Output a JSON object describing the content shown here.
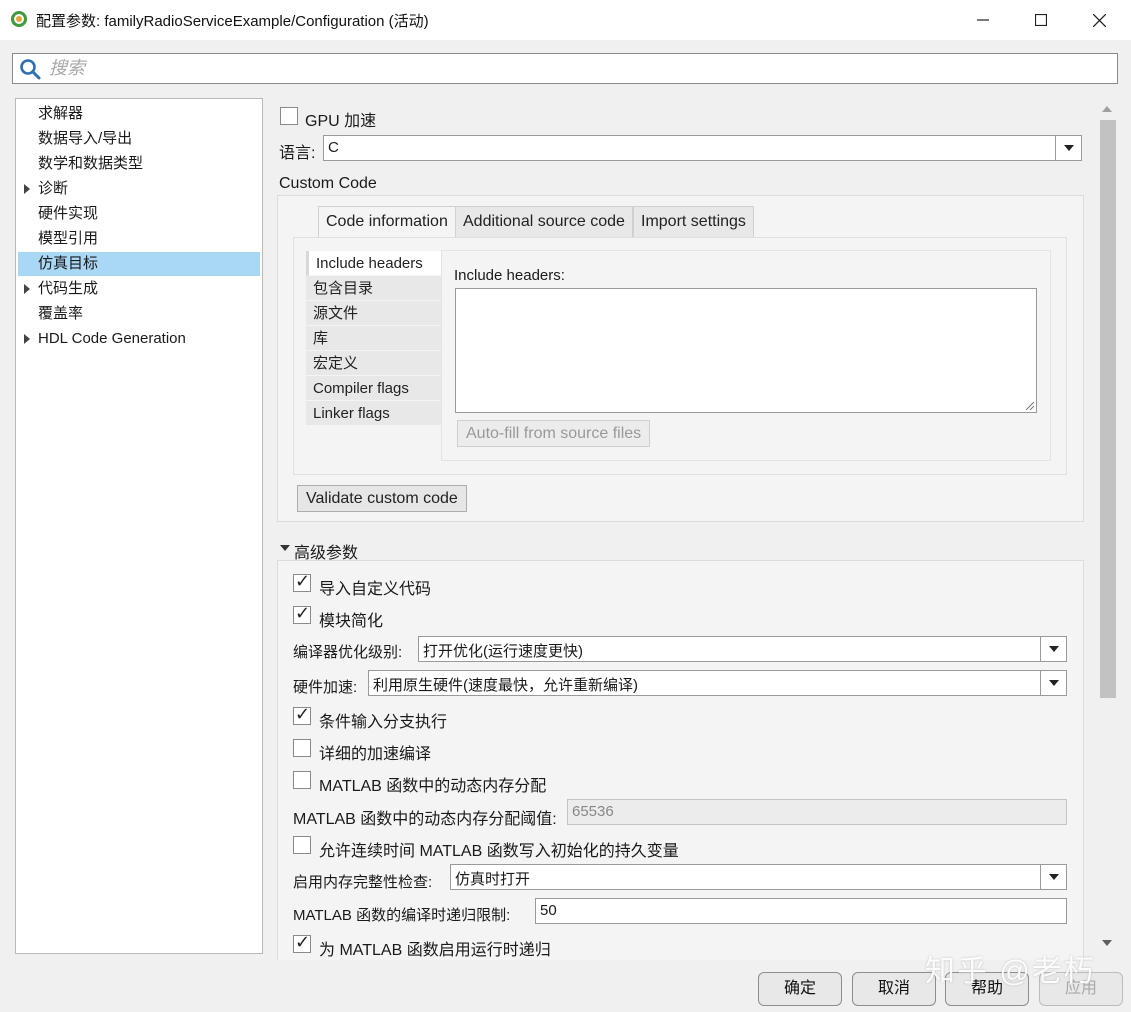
{
  "window": {
    "title": "配置参数: familyRadioServiceExample/Configuration (活动)",
    "icon": "simulink-config-icon",
    "controls": [
      "minimize-icon",
      "maximize-icon",
      "close-icon"
    ]
  },
  "search": {
    "placeholder": "搜索",
    "value": ""
  },
  "tree": {
    "items": [
      {
        "label": "求解器",
        "expandable": false,
        "selected": false
      },
      {
        "label": "数据导入/导出",
        "expandable": false,
        "selected": false
      },
      {
        "label": "数学和数据类型",
        "expandable": false,
        "selected": false
      },
      {
        "label": "诊断",
        "expandable": true,
        "selected": false
      },
      {
        "label": "硬件实现",
        "expandable": false,
        "selected": false
      },
      {
        "label": "模型引用",
        "expandable": false,
        "selected": false
      },
      {
        "label": "仿真目标",
        "expandable": false,
        "selected": true
      },
      {
        "label": "代码生成",
        "expandable": true,
        "selected": false
      },
      {
        "label": "覆盖率",
        "expandable": false,
        "selected": false
      },
      {
        "label": "HDL Code Generation",
        "expandable": true,
        "selected": false
      }
    ]
  },
  "main": {
    "gpu_label": "GPU 加速",
    "gpu_checked": false,
    "language_label": "语言:",
    "language_value": "C",
    "custom_code_heading": "Custom Code",
    "tabs": [
      {
        "label": "Code information",
        "active": true
      },
      {
        "label": "Additional source code",
        "active": false
      },
      {
        "label": "Import settings",
        "active": false
      }
    ],
    "side_tabs": [
      {
        "label": "Include headers",
        "active": true
      },
      {
        "label": "包含目录",
        "active": false
      },
      {
        "label": "源文件",
        "active": false
      },
      {
        "label": "库",
        "active": false
      },
      {
        "label": "宏定义",
        "active": false
      },
      {
        "label": "Compiler flags",
        "active": false
      },
      {
        "label": "Linker flags",
        "active": false
      }
    ],
    "include_headers_label": "Include headers:",
    "include_headers_value": "",
    "autofill_button": "Auto-fill from source files",
    "validate_button": "Validate custom code",
    "advanced_heading": "高级参数",
    "advanced": {
      "import_custom_code": {
        "label": "导入自定义代码",
        "checked": true
      },
      "block_reduction": {
        "label": "模块简化",
        "checked": true
      },
      "compiler_opt_label": "编译器优化级别:",
      "compiler_opt_value": "打开优化(运行速度更快)",
      "hw_accel_label": "硬件加速:",
      "hw_accel_value": "利用原生硬件(速度最快，允许重新编译)",
      "conditional_branch": {
        "label": "条件输入分支执行",
        "checked": true
      },
      "verbose_accel": {
        "label": "详细的加速编译",
        "checked": false
      },
      "dynamic_mem": {
        "label": "MATLAB 函数中的动态内存分配",
        "checked": false
      },
      "dynamic_mem_threshold_label": "MATLAB 函数中的动态内存分配阈值:",
      "dynamic_mem_threshold_value": "65536",
      "persistent_vars": {
        "label": "允许连续时间 MATLAB 函数写入初始化的持久变量",
        "checked": false
      },
      "mem_integrity_label": "启用内存完整性检查:",
      "mem_integrity_value": "仿真时打开",
      "recursion_limit_label": "MATLAB 函数的编译时递归限制:",
      "recursion_limit_value": "50",
      "runtime_recursion": {
        "label": "为 MATLAB 函数启用运行时递归",
        "checked": true
      }
    }
  },
  "footer": {
    "ok": "确定",
    "cancel": "取消",
    "help": "帮助",
    "apply": "应用"
  },
  "watermark": "知乎 @老朽"
}
